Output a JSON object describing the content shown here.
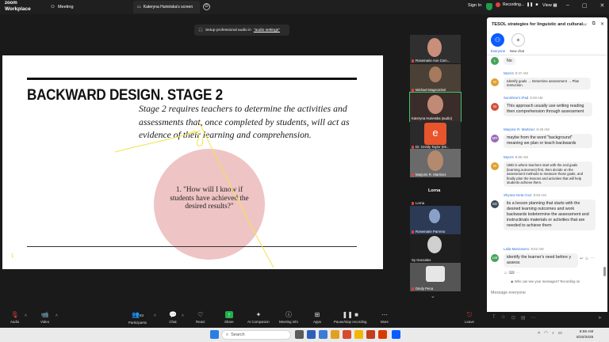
{
  "titlebar": {
    "logo_line1": "zoom",
    "logo_line2": "Workplace",
    "tab_meeting": "Meeting",
    "tab_share": "Kateryna Hurietska's screen",
    "new_tab_glyph": "⊖",
    "sign_in": "Sign In",
    "recording": "Recording...",
    "view": "View"
  },
  "audio_banner": {
    "text": "Setup professional audio in",
    "link": "\"audio settings\""
  },
  "slide": {
    "title": "BACKWARD DESIGN. STAGE 2",
    "body": "Stage 2 requires teachers to determine the activities and assessments that, once completed by students, will act as evidence of their learning and comprehension.",
    "question": "1. \"How will I know if students have achieved the desired results?\""
  },
  "participants": [
    {
      "name": "Rosemarie Ann Com...",
      "muted": false
    },
    {
      "name": "Michael Magsombol",
      "muted": false
    },
    {
      "name": "Kateryna Hurietska (audio)",
      "muted": false
    },
    {
      "name": "Dr. Gresly Taylor (Mi...",
      "muted": true,
      "avatar_letter": "e"
    },
    {
      "name": "Marjorie R. Martinez",
      "muted": true
    },
    {
      "name": "Lorna",
      "muted": true,
      "is_name_only": true
    },
    {
      "name": "Rosemarie Parreno",
      "muted": true
    },
    {
      "name": "Sy Gonzales",
      "muted": false
    },
    {
      "name": "Dindy Pena",
      "muted": true
    }
  ],
  "lorna_heading": "Lorna",
  "chat": {
    "title": "TESOL strategies for linguistic and cultural...",
    "everyone_label": "Everyone",
    "new_chat_label": "New chat",
    "privacy": "Who can see your messages? Recording on",
    "input_placeholder": "Message everyone",
    "messages": [
      {
        "initial": "L",
        "avatar_color": "#46a35b",
        "sender": "",
        "time": "",
        "text": "No"
      },
      {
        "initial": "M",
        "avatar_color": "#e0a030",
        "sender": "Myra's",
        "time": "8:47 AM",
        "text": "Identify goals → Determine assessment → Plan instruction."
      },
      {
        "initial": "SI",
        "avatar_color": "#d2503a",
        "sender": "Sunshine's iPad",
        "time": "8:48 AM",
        "text": "This approach usually use writing reading then comprehension through assessment"
      },
      {
        "initial": "MR",
        "avatar_color": "#9a6ab8",
        "sender": "Marjorie R. Martinez",
        "time": "8:48 AM",
        "text": "maybe from the word \"background\" meaning we plan or teach backwards"
      },
      {
        "initial": "M",
        "avatar_color": "#e0a030",
        "sender": "Myra's",
        "time": "8:50 AM",
        "text": "UBD is where teachers start with the end goals (learning outcomes) first, then decide on the assessment methods to measure those goals, and finally plan the lessons and activities that will help students achieve them."
      },
      {
        "initial": "SD",
        "avatar_color": "#3d4a5a",
        "sender": "Shynne Dela Cruz",
        "time": "8:50 AM",
        "text": "its a lesson planning that starts with the desired learning outcomes and work backwards todetermine the assessment and instructinals materials or activities that are needed to achieve them"
      },
      {
        "initial": "LM",
        "avatar_color": "#46a35b",
        "sender": "Laila Manzanero",
        "time": "8:52 AM",
        "text": "identify the learner's need before y assess"
      }
    ]
  },
  "toolbar": {
    "audio": "Audio",
    "video": "Video",
    "participants": "Participants",
    "participants_count": "83",
    "chat": "Chat",
    "react": "React",
    "share": "Share",
    "ai_companion": "AI Companion",
    "meeting_info": "Meeting info",
    "apps": "Apps",
    "pause_recording": "Pause/stop recording",
    "more": "More",
    "leave": "Leave"
  },
  "taskbar": {
    "search_placeholder": "Search",
    "time": "8:59 AM",
    "date": "8/20/2025"
  },
  "colors": {
    "accent": "#0b5cff",
    "active_speaker": "#3cc46b",
    "slide_circle": "#efc4c4",
    "share_green": "#22b04b"
  }
}
